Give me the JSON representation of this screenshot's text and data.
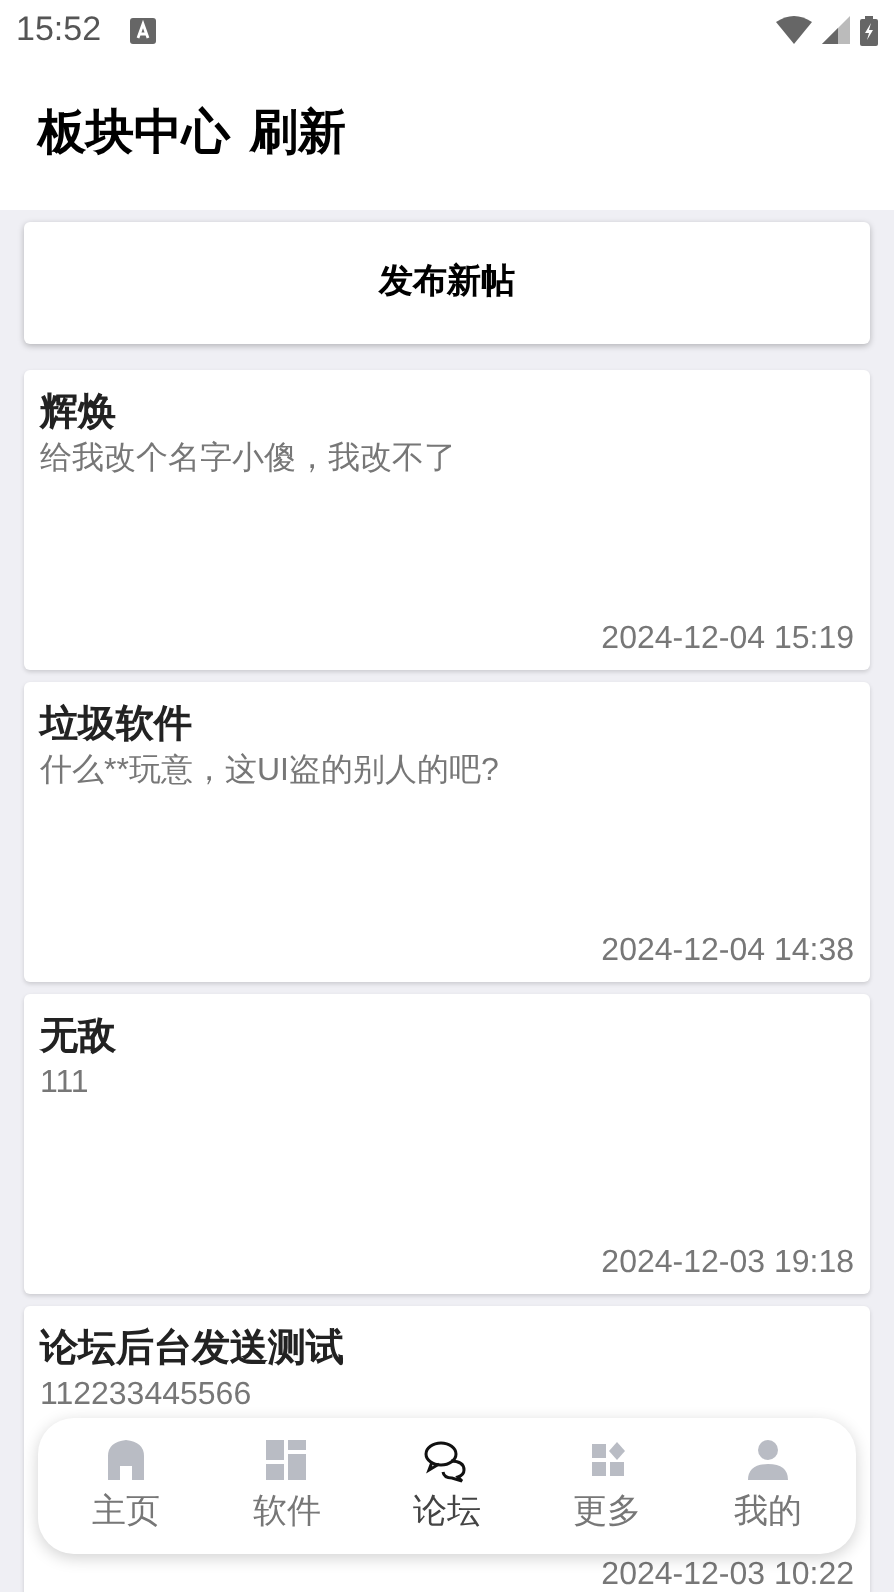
{
  "status_bar": {
    "time": "15:52"
  },
  "header": {
    "title": "板块中心",
    "action": "刷新"
  },
  "publish_button": {
    "label": "发布新帖"
  },
  "posts": [
    {
      "title": "辉焕",
      "body": "给我改个名字小傻，我改不了",
      "time": "2024-12-04 15:19"
    },
    {
      "title": "垃圾软件",
      "body": "什么**玩意，这UI盗的别人的吧?",
      "time": "2024-12-04 14:38"
    },
    {
      "title": "无敌",
      "body": "111",
      "time": "2024-12-03 19:18"
    },
    {
      "title": "论坛后台发送测试",
      "body": "112233445566",
      "time": "2024-12-03 10:22"
    }
  ],
  "bottom_nav": [
    {
      "kind": "home",
      "label": "主页",
      "selected": false
    },
    {
      "kind": "apps",
      "label": "软件",
      "selected": false
    },
    {
      "kind": "forum",
      "label": "论坛",
      "selected": true
    },
    {
      "kind": "more",
      "label": "更多",
      "selected": false
    },
    {
      "kind": "profile",
      "label": "我的",
      "selected": false
    }
  ]
}
